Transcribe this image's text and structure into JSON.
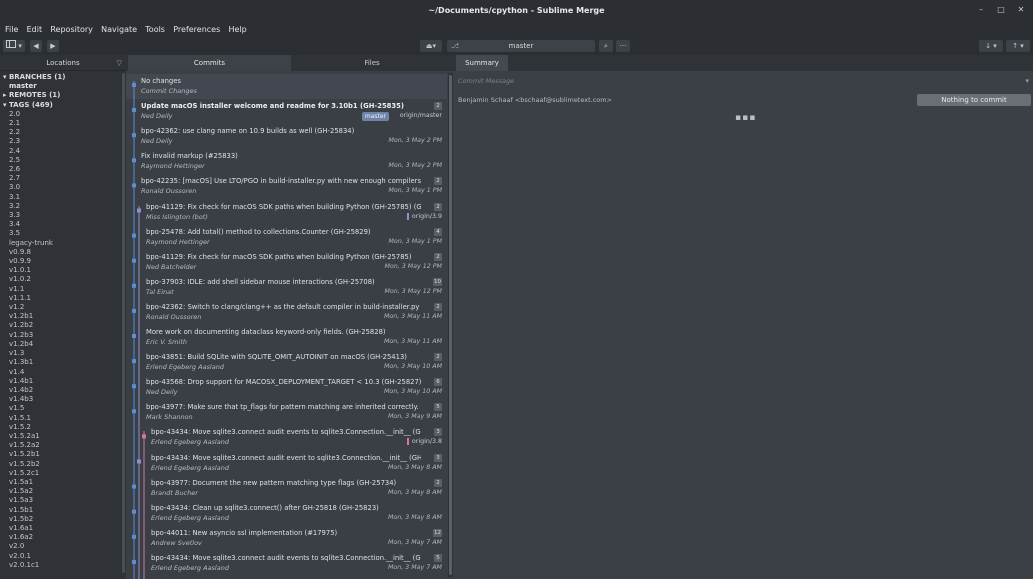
{
  "window": {
    "title": "~/Documents/cpython - Sublime Merge",
    "minimize": "–",
    "maximize": "□",
    "close": "✕"
  },
  "menu": [
    "File",
    "Edit",
    "Repository",
    "Navigate",
    "Tools",
    "Preferences",
    "Help"
  ],
  "toolbar": {
    "branch": "master",
    "search_icon": "⌕",
    "more_icon": "···",
    "fetch_icon": "↓",
    "push_icon": "↑",
    "dropdown_icon": "▾"
  },
  "locations": {
    "title": "Locations",
    "branches_label": "BRANCHES (1)",
    "branches": [
      "master"
    ],
    "remotes_label": "REMOTES (1)",
    "tags_label": "TAGS (469)",
    "tags": [
      "2.0",
      "2.1",
      "2.2",
      "2.3",
      "2.4",
      "2.5",
      "2.6",
      "2.7",
      "3.0",
      "3.1",
      "3.2",
      "3.3",
      "3.4",
      "3.5",
      "legacy-trunk",
      "v0.9.8",
      "v0.9.9",
      "v1.0.1",
      "v1.0.2",
      "v1.1",
      "v1.1.1",
      "v1.2",
      "v1.2b1",
      "v1.2b2",
      "v1.2b3",
      "v1.2b4",
      "v1.3",
      "v1.3b1",
      "v1.4",
      "v1.4b1",
      "v1.4b2",
      "v1.4b3",
      "v1.5",
      "v1.5.1",
      "v1.5.2",
      "v1.5.2a1",
      "v1.5.2a2",
      "v1.5.2b1",
      "v1.5.2b2",
      "v1.5.2c1",
      "v1.5a1",
      "v1.5a2",
      "v1.5a3",
      "v1.5b1",
      "v1.5b2",
      "v1.6a1",
      "v1.6a2",
      "v2.0",
      "v2.0.1",
      "v2.0.1c1"
    ]
  },
  "tabs": {
    "commits": "Commits",
    "files": "Files",
    "summary": "Summary"
  },
  "commits": [
    {
      "subject": "No changes",
      "author": "Commit Changes",
      "date": "",
      "badge": "",
      "ref": "",
      "bold": false,
      "selected": true
    },
    {
      "subject": "Update macOS installer welcome and readme for 3.10b1 (GH-25835)",
      "author": "Ned Deily",
      "date": "",
      "badge": "2",
      "ref": "origin/master",
      "tag": "master",
      "bold": true
    },
    {
      "subject": "bpo-42362: use clang name on 10.9 builds as well (GH-25834)",
      "author": "Ned Deily",
      "date": "Mon, 3 May 2 PM",
      "badge": "",
      "ref": ""
    },
    {
      "subject": "Fix invalid markup (#25833)",
      "author": "Raymond Hettinger",
      "date": "Mon, 3 May 2 PM",
      "badge": "",
      "ref": ""
    },
    {
      "subject": "bpo-42235: [macOS] Use LTO/PGO in build-installer.py with new enough compilers (GH-23079)",
      "author": "Ronald Oussoren",
      "date": "Mon, 3 May 1 PM",
      "badge": "2",
      "ref": ""
    },
    {
      "subject": "bpo-41129: Fix check for macOS SDK paths when building Python (GH-25785) (GH-25830)",
      "author": "Miss Islington (bot)",
      "date": "",
      "badge": "2",
      "ref": "origin/3.9"
    },
    {
      "subject": "bpo-25478: Add total() method to collections.Counter (GH-25829)",
      "author": "Raymond Hettinger",
      "date": "Mon, 3 May 1 PM",
      "badge": "4",
      "ref": ""
    },
    {
      "subject": "bpo-41129: Fix check for macOS SDK paths when building Python (GH-25785)",
      "author": "Ned Batchelder",
      "date": "Mon, 3 May 12 PM",
      "badge": "2",
      "ref": ""
    },
    {
      "subject": "bpo-37903: IDLE: add shell sidebar mouse interactions (GH-25708)",
      "author": "Tal Einat",
      "date": "Mon, 3 May 12 PM",
      "badge": "10",
      "ref": ""
    },
    {
      "subject": "bpo-42362: Switch to clang/clang++ as the default compiler in build-installer.py (GH-23298)",
      "author": "Ronald Oussoren",
      "date": "Mon, 3 May 11 AM",
      "badge": "2",
      "ref": ""
    },
    {
      "subject": "More work on documenting dataclass keyword-only fields. (GH-25828)",
      "author": "Eric V. Smith",
      "date": "Mon, 3 May 11 AM",
      "badge": "",
      "ref": ""
    },
    {
      "subject": "bpo-43851: Build SQLite with SQLITE_OMIT_AUTOINIT on macOS (GH-25413)",
      "author": "Erlend Egeberg Aasland",
      "date": "Mon, 3 May 10 AM",
      "badge": "2",
      "ref": ""
    },
    {
      "subject": "bpo-43568: Drop support for MACOSX_DEPLOYMENT_TARGET < 10.3 (GH-25827)",
      "author": "Ned Deily",
      "date": "Mon, 3 May 10 AM",
      "badge": "6",
      "ref": ""
    },
    {
      "subject": "bpo-43977: Make sure that tp_flags for pattern matching are inherited correctly. (GH-25813)",
      "author": "Mark Shannon",
      "date": "Mon, 3 May 9 AM",
      "badge": "5",
      "ref": ""
    },
    {
      "subject": "bpo-43434: Move sqlite3.connect audit events to sqlite3.Connection.__init__ (GH-25818)",
      "author": "Erlend Egeberg Aasland",
      "date": "",
      "badge": "3",
      "ref": "origin/3.8"
    },
    {
      "subject": "bpo-43434: Move sqlite3.connect audit event to sqlite3.Connection.__init__ (GH-25818)",
      "author": "Erlend Egeberg Aasland",
      "date": "Mon, 3 May 8 AM",
      "badge": "3",
      "ref": ""
    },
    {
      "subject": "bpo-43977: Document the new pattern matching type flags (GH-25734)",
      "author": "Brandt Bucher",
      "date": "Mon, 3 May 8 AM",
      "badge": "2",
      "ref": ""
    },
    {
      "subject": "bpo-43434: Clean up sqlite3.connect() after GH-25818 (GH-25823)",
      "author": "Erlend Egeberg Aasland",
      "date": "Mon, 3 May 8 AM",
      "badge": "",
      "ref": ""
    },
    {
      "subject": "bpo-44011: New asyncio ssl implementation (#17975)",
      "author": "Andrew Svetlov",
      "date": "Mon, 3 May 7 AM",
      "badge": "12",
      "ref": ""
    },
    {
      "subject": "bpo-43434: Move sqlite3.connect audit events to sqlite3.Connection.__init__ (GH-25818)",
      "author": "Erlend Egeberg Aasland",
      "date": "Mon, 3 May 7 AM",
      "badge": "5",
      "ref": ""
    }
  ],
  "summary": {
    "message_placeholder": "Commit Message",
    "author": "Benjamin Schaaf <bschaaf@sublimetext.com>",
    "commit_button": "Nothing to commit",
    "dots": "▪▪▪"
  },
  "colors": {
    "graph_main": "#5b8fd1",
    "graph_purple": "#8d8fd1",
    "graph_pink": "#d27a9b"
  }
}
